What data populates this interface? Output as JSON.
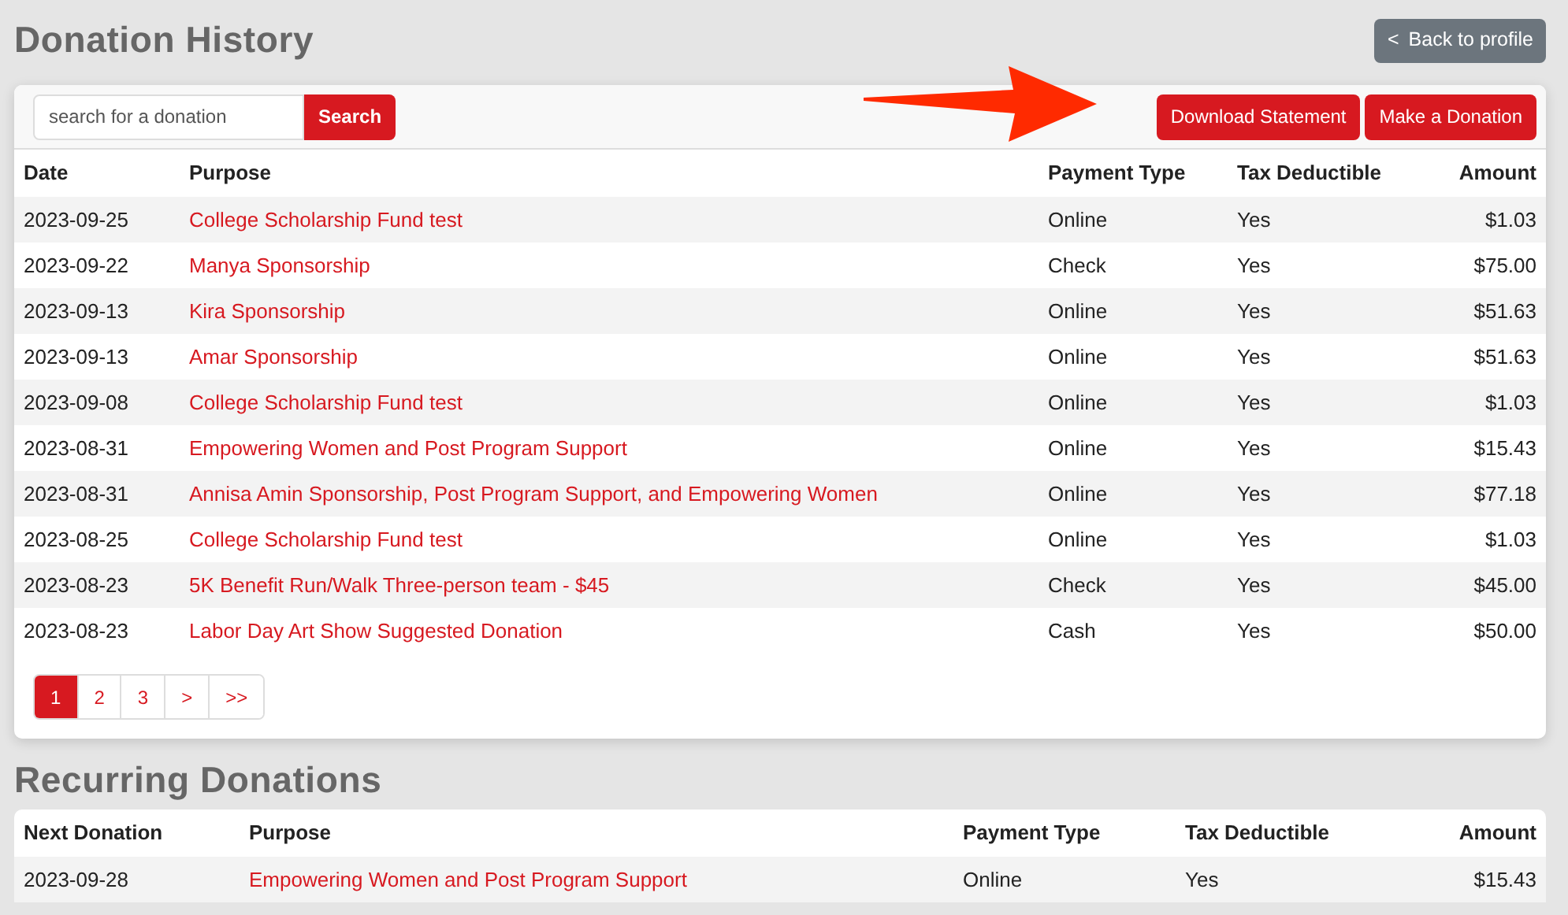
{
  "title": "Donation History",
  "back_button": {
    "icon": "<",
    "label": "Back to profile"
  },
  "search": {
    "placeholder": "search for a donation",
    "button": "Search"
  },
  "actions": [
    "Download Statement",
    "Make a Donation"
  ],
  "history": {
    "columns": [
      "Date",
      "Purpose",
      "Payment Type",
      "Tax Deductible",
      "Amount"
    ],
    "rows": [
      [
        "2023-09-25",
        "College Scholarship Fund test",
        "Online",
        "Yes",
        "$1.03"
      ],
      [
        "2023-09-22",
        "Manya Sponsorship",
        "Check",
        "Yes",
        "$75.00"
      ],
      [
        "2023-09-13",
        "Kira Sponsorship",
        "Online",
        "Yes",
        "$51.63"
      ],
      [
        "2023-09-13",
        "Amar Sponsorship",
        "Online",
        "Yes",
        "$51.63"
      ],
      [
        "2023-09-08",
        "College Scholarship Fund test",
        "Online",
        "Yes",
        "$1.03"
      ],
      [
        "2023-08-31",
        "Empowering Women and Post Program Support",
        "Online",
        "Yes",
        "$15.43"
      ],
      [
        "2023-08-31",
        "Annisa Amin Sponsorship, Post Program Support, and Empowering Women",
        "Online",
        "Yes",
        "$77.18"
      ],
      [
        "2023-08-25",
        "College Scholarship Fund test",
        "Online",
        "Yes",
        "$1.03"
      ],
      [
        "2023-08-23",
        "5K Benefit Run/Walk Three-person team - $45",
        "Check",
        "Yes",
        "$45.00"
      ],
      [
        "2023-08-23",
        "Labor Day Art Show Suggested Donation",
        "Cash",
        "Yes",
        "$50.00"
      ]
    ]
  },
  "pagination": [
    {
      "label": "1",
      "selected": true
    },
    {
      "label": "2",
      "selected": false
    },
    {
      "label": "3",
      "selected": false
    },
    {
      "label": ">",
      "selected": false
    },
    {
      "label": ">>",
      "selected": false
    }
  ],
  "recurring_title": "Recurring Donations",
  "recurring": {
    "columns": [
      "Next Donation",
      "Purpose",
      "Payment Type",
      "Tax Deductible",
      "Amount"
    ],
    "rows": [
      [
        "2023-09-28",
        "Empowering Women and Post Program Support",
        "Online",
        "Yes",
        "$15.43"
      ]
    ]
  }
}
